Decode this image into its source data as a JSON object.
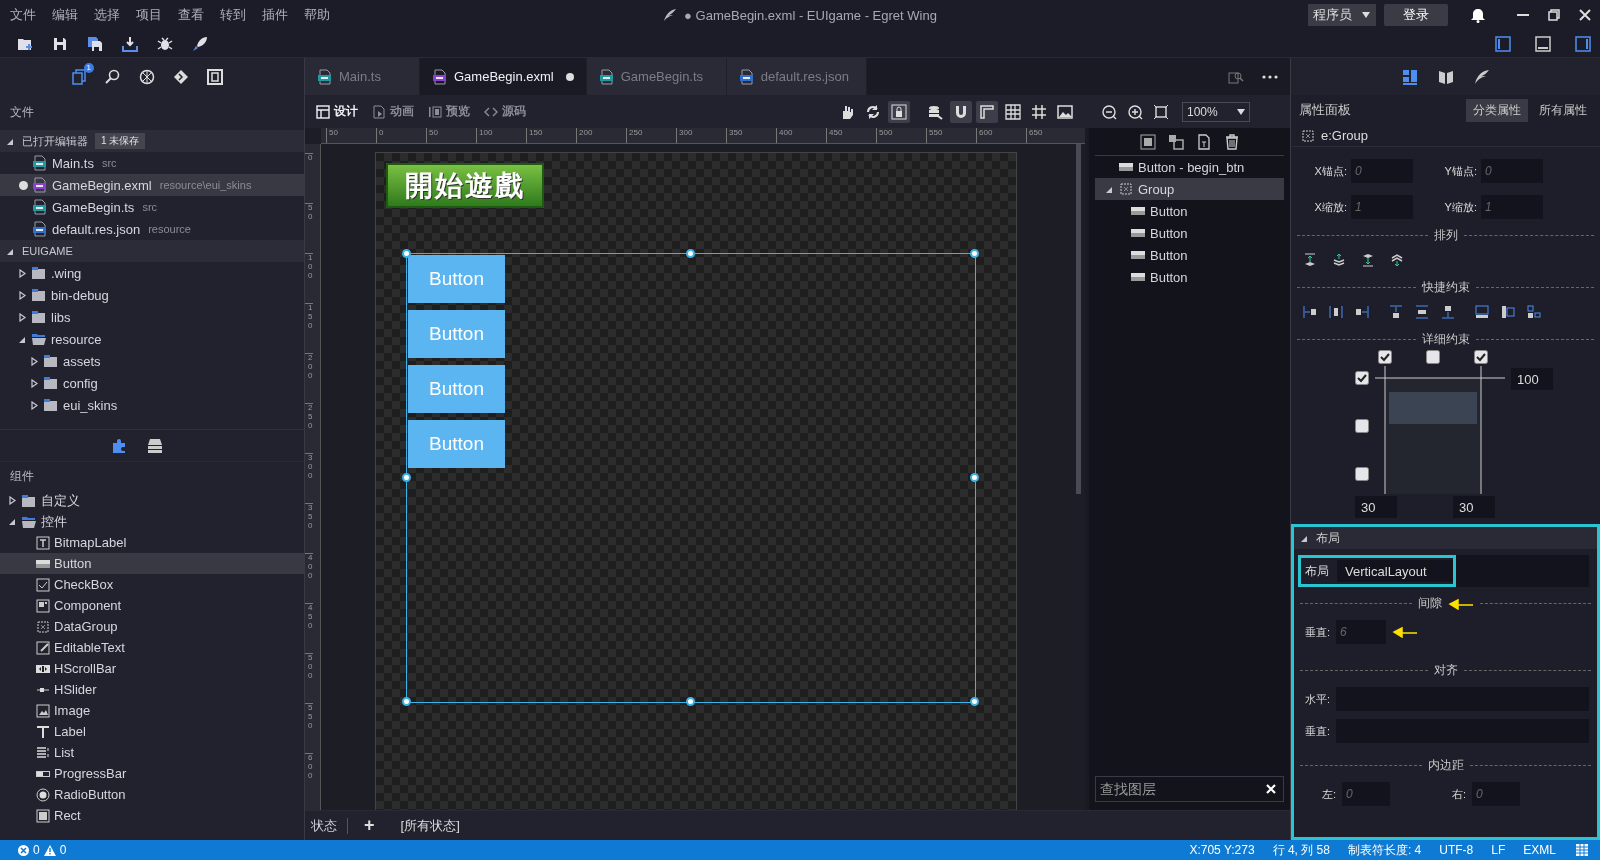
{
  "window": {
    "title": "● GameBegin.exml - EUIgame - Egret Wing"
  },
  "menu": [
    "文件",
    "编辑",
    "选择",
    "项目",
    "查看",
    "转到",
    "插件",
    "帮助"
  ],
  "account": {
    "role": "程序员",
    "login": "登录"
  },
  "activity_badge": "1",
  "explorer": {
    "title": "文件",
    "open_editors": {
      "label": "已打开编辑器",
      "badge": "1 未保存",
      "expanded": true,
      "items": [
        {
          "name": "Main.ts",
          "path": "src",
          "kind": "ts",
          "modified": false,
          "selected": false
        },
        {
          "name": "GameBegin.exml",
          "path": "resource\\eui_skins",
          "kind": "exml",
          "modified": true,
          "selected": true
        },
        {
          "name": "GameBegin.ts",
          "path": "src",
          "kind": "ts",
          "modified": false,
          "selected": false
        },
        {
          "name": "default.res.json",
          "path": "resource",
          "kind": "json",
          "modified": false,
          "selected": false
        }
      ]
    },
    "project": {
      "label": "EUIGAME",
      "expanded": true,
      "children": [
        {
          "name": ".wing",
          "expanded": false
        },
        {
          "name": "bin-debug",
          "expanded": false
        },
        {
          "name": "libs",
          "expanded": false
        },
        {
          "name": "resource",
          "expanded": true,
          "children": [
            {
              "name": "assets",
              "expanded": false
            },
            {
              "name": "config",
              "expanded": false
            },
            {
              "name": "eui_skins",
              "expanded": false
            }
          ]
        }
      ]
    }
  },
  "components": {
    "title": "组件",
    "groups": [
      {
        "name": "自定义",
        "expanded": false
      },
      {
        "name": "控件",
        "expanded": true,
        "children": [
          {
            "name": "BitmapLabel",
            "selected": false
          },
          {
            "name": "Button",
            "selected": true
          },
          {
            "name": "CheckBox",
            "selected": false
          },
          {
            "name": "Component",
            "selected": false
          },
          {
            "name": "DataGroup",
            "selected": false
          },
          {
            "name": "EditableText",
            "selected": false
          },
          {
            "name": "HScrollBar",
            "selected": false
          },
          {
            "name": "HSlider",
            "selected": false
          },
          {
            "name": "Image",
            "selected": false
          },
          {
            "name": "Label",
            "selected": false
          },
          {
            "name": "List",
            "selected": false
          },
          {
            "name": "ProgressBar",
            "selected": false
          },
          {
            "name": "RadioButton",
            "selected": false
          },
          {
            "name": "Rect",
            "selected": false
          }
        ]
      }
    ]
  },
  "tabs": [
    {
      "label": "Main.ts",
      "kind": "ts",
      "selected": false,
      "modified": false
    },
    {
      "label": "GameBegin.exml",
      "kind": "exml",
      "selected": true,
      "modified": true
    },
    {
      "label": "GameBegin.ts",
      "kind": "ts",
      "selected": false,
      "modified": false
    },
    {
      "label": "default.res.json",
      "kind": "json",
      "selected": false,
      "modified": false
    }
  ],
  "editor_modes": [
    {
      "label": "设计",
      "selected": true
    },
    {
      "label": "动画",
      "selected": false
    },
    {
      "label": "预览",
      "selected": false
    },
    {
      "label": "源码",
      "selected": false
    }
  ],
  "tools": [
    {
      "kind": "hand",
      "on": false
    },
    {
      "kind": "refresh",
      "on": false
    },
    {
      "kind": "lock",
      "on": true
    },
    {
      "kind": "stack",
      "on": false
    },
    {
      "kind": "magnet",
      "on": true
    },
    {
      "kind": "corner",
      "on": true
    },
    {
      "kind": "grid",
      "on": false
    },
    {
      "kind": "hash",
      "on": false
    },
    {
      "kind": "picture",
      "on": false
    }
  ],
  "zoom": "100%",
  "canvas": {
    "h_ticks": [
      "50",
      "0",
      "50",
      "100",
      "150",
      "200",
      "250",
      "300",
      "350",
      "400",
      "450",
      "500",
      "550",
      "600",
      "650"
    ],
    "v_ticks": [
      "0",
      "50",
      "100",
      "150",
      "200",
      "250",
      "300",
      "350",
      "400",
      "450",
      "500",
      "550",
      "600"
    ],
    "title_image": "開始遊戲",
    "buttons": [
      "Button",
      "Button",
      "Button",
      "Button"
    ]
  },
  "layers": {
    "items": [
      {
        "name": "Button - begin_btn",
        "kind": "button",
        "selected": false
      },
      {
        "name": "Group",
        "kind": "group",
        "selected": true,
        "expanded": true,
        "children": [
          {
            "name": "Button",
            "kind": "button",
            "selected": false
          },
          {
            "name": "Button",
            "kind": "button",
            "selected": false
          },
          {
            "name": "Button",
            "kind": "button",
            "selected": false
          },
          {
            "name": "Button",
            "kind": "button",
            "selected": false
          }
        ]
      }
    ],
    "search_placeholder": "查找图层"
  },
  "states": {
    "label": "状态",
    "add": "+",
    "current": "[所有状态]"
  },
  "properties": {
    "title": "属性面板",
    "tabs": [
      {
        "label": "分类属性",
        "selected": true
      },
      {
        "label": "所有属性",
        "selected": false
      }
    ],
    "target": "e:Group",
    "transform": [
      {
        "label": "X锚点:",
        "placeholder": "0"
      },
      {
        "label": "Y锚点:",
        "placeholder": "0"
      },
      {
        "label": "X缩放:",
        "placeholder": "1"
      },
      {
        "label": "Y缩放:",
        "placeholder": "1"
      }
    ],
    "arrange_title": "排列",
    "quick_title": "快捷约束",
    "detail_title": "详细约束",
    "constraints": {
      "top": [
        {
          "checked": true
        },
        {
          "checked": false
        },
        {
          "checked": true
        }
      ],
      "left": [
        {
          "checked": true
        },
        {
          "checked": false
        },
        {
          "checked": false
        }
      ],
      "top_value": "100",
      "left_value": "30",
      "right_value": "30"
    },
    "layout": {
      "title": "布局",
      "expanded": true,
      "label": "布局",
      "value": "VerticalLayout",
      "gap_title": "间隙",
      "vertical_label": "垂直:",
      "vertical_placeholder": "6",
      "align_title": "对齐",
      "horizontal_label": "水平:",
      "vertical_align_label": "垂直:",
      "padding_title": "内边距",
      "padding": [
        {
          "label": "左:",
          "placeholder": "0"
        },
        {
          "label": "右:",
          "placeholder": "0"
        }
      ]
    }
  },
  "status": {
    "errors": "0",
    "warnings": "0",
    "items": [
      "X:705 Y:273",
      "行 4, 列 58",
      "制表符长度: 4",
      "UTF-8",
      "LF",
      "EXML"
    ]
  }
}
